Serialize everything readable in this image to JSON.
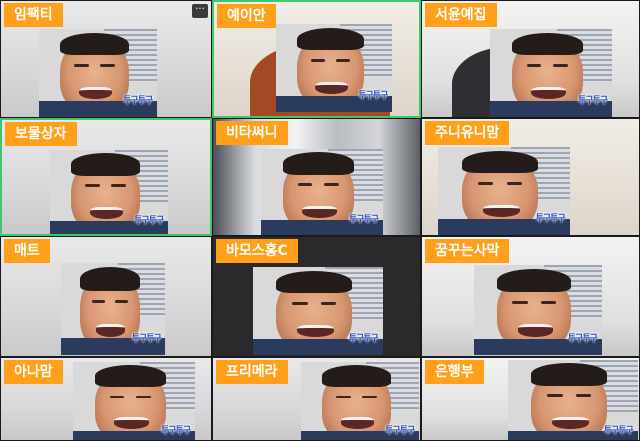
{
  "participants": [
    {
      "name": "임팩티"
    },
    {
      "name": "예이안"
    },
    {
      "name": "서윤예집"
    },
    {
      "name": "보물상자"
    },
    {
      "name": "비타써니"
    },
    {
      "name": "주니유니맘"
    },
    {
      "name": "매트"
    },
    {
      "name": "바모스홍C"
    },
    {
      "name": "꿈꾸는사막"
    },
    {
      "name": "아나맘"
    },
    {
      "name": "프리메라"
    },
    {
      "name": "은행부"
    }
  ],
  "overlay_caption": "투구투구",
  "more_button_label": "···",
  "colors": {
    "name_tag": "#ff9f1a",
    "active_speaker_border": "#3fc76b",
    "background": "#1f1f21"
  }
}
